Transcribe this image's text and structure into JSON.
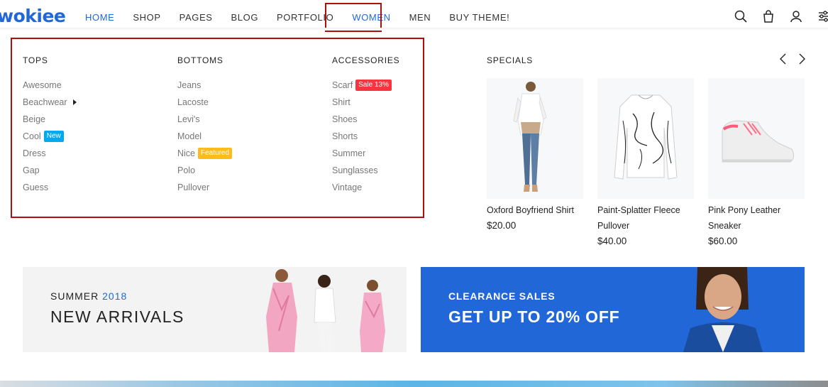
{
  "logo": "wokiee",
  "nav": {
    "items": [
      "HOME",
      "SHOP",
      "PAGES",
      "BLOG",
      "PORTFOLIO",
      "WOMEN",
      "MEN",
      "BUY THEME!"
    ]
  },
  "header_icons": [
    "search-icon",
    "bag-icon",
    "user-icon",
    "settings-icon"
  ],
  "menu": {
    "columns": [
      {
        "title": "TOPS",
        "items": [
          {
            "label": "Awesome",
            "badge": ""
          },
          {
            "label": "Beachwear",
            "badge": ""
          },
          {
            "label": "Beige",
            "badge": ""
          },
          {
            "label": "Cool",
            "badge": "New"
          },
          {
            "label": "Dress",
            "badge": ""
          },
          {
            "label": "Gap",
            "badge": ""
          },
          {
            "label": "Guess",
            "badge": ""
          }
        ]
      },
      {
        "title": "BOTTOMS",
        "items": [
          {
            "label": "Jeans",
            "badge": ""
          },
          {
            "label": "Lacoste",
            "badge": ""
          },
          {
            "label": "Levi's",
            "badge": ""
          },
          {
            "label": "Model",
            "badge": ""
          },
          {
            "label": "Nice",
            "badge": "Featured"
          },
          {
            "label": "Polo",
            "badge": ""
          },
          {
            "label": "Pullover",
            "badge": ""
          }
        ]
      },
      {
        "title": "ACCESSORIES",
        "items": [
          {
            "label": "Scarf",
            "badge": "Sale 13%"
          },
          {
            "label": "Shirt",
            "badge": ""
          },
          {
            "label": "Shoes",
            "badge": ""
          },
          {
            "label": "Shorts",
            "badge": ""
          },
          {
            "label": "Summer",
            "badge": ""
          },
          {
            "label": "Sunglasses",
            "badge": ""
          },
          {
            "label": "Vintage",
            "badge": ""
          }
        ]
      }
    ]
  },
  "specials": {
    "title": "SPECIALS",
    "products": [
      {
        "name_lines": [
          "Oxford Boyfriend Shirt"
        ],
        "price": "$20.00"
      },
      {
        "name_lines": [
          "Paint-Splatter Fleece",
          "Pullover"
        ],
        "price": "$40.00"
      },
      {
        "name_lines": [
          "Pink Pony Leather",
          "Sneaker"
        ],
        "price": "$60.00"
      }
    ]
  },
  "banners": {
    "left": {
      "sub": "SUMMER",
      "year": "2018",
      "main": "NEW ARRIVALS"
    },
    "right": {
      "sub": "CLEARANCE SALES",
      "main": "GET UP TO 20% OFF"
    }
  },
  "colors": {
    "accent": "#2267d8",
    "highlight_border": "#b00d0d",
    "badge_sale": "#f8353e",
    "badge_new": "#03a9ef",
    "badge_featured": "#fdbc1c"
  }
}
